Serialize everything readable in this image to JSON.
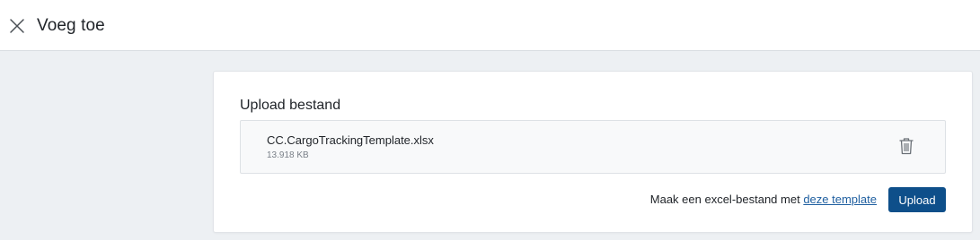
{
  "header": {
    "title": "Voeg toe",
    "close_icon": "close-icon"
  },
  "upload": {
    "section_title": "Upload bestand",
    "file": {
      "name": "CC.CargoTrackingTemplate.xlsx",
      "size": "13.918 KB",
      "delete_icon": "trash-icon"
    },
    "hint_text": "Maak een excel-bestand met",
    "template_link": "deze template",
    "upload_button": "Upload"
  },
  "colors": {
    "primary": "#0e4f8a",
    "link": "#1f5fa0",
    "background": "#edf0f3"
  }
}
